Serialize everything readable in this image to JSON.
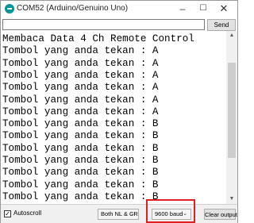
{
  "window": {
    "title": "COM52 (Arduino/Genuino Uno)",
    "min_glyph": "–",
    "max_glyph": "☐",
    "close_glyph": "✕"
  },
  "input": {
    "value": "",
    "send_label": "Send"
  },
  "output": {
    "lines": [
      "Membaca Data 4 Ch Remote Control",
      "Tombol yang anda tekan : A",
      "Tombol yang anda tekan : A",
      "Tombol yang anda tekan : A",
      "Tombol yang anda tekan : A",
      "Tombol yang anda tekan : A",
      "Tombol yang anda tekan : A",
      "Tombol yang anda tekan : B",
      "Tombol yang anda tekan : B",
      "Tombol yang anda tekan : B",
      "Tombol yang anda tekan : B",
      "Tombol yang anda tekan : B",
      "Tombol yang anda tekan : B",
      "Tombol yang anda tekan : B"
    ]
  },
  "statusbar": {
    "autoscroll_label": "Autoscroll",
    "autoscroll_checked": true,
    "line_ending": "Both NL & CR",
    "baud_rate": "9600 baud",
    "clear_label": "Clear output"
  },
  "colors": {
    "app_icon": "#00979c",
    "highlight": "#e02020"
  },
  "icons": {
    "app": "arduino-icon",
    "minimize": "minimize-icon",
    "maximize": "maximize-icon",
    "close": "close-icon",
    "dropdown": "chevron-down-icon"
  }
}
